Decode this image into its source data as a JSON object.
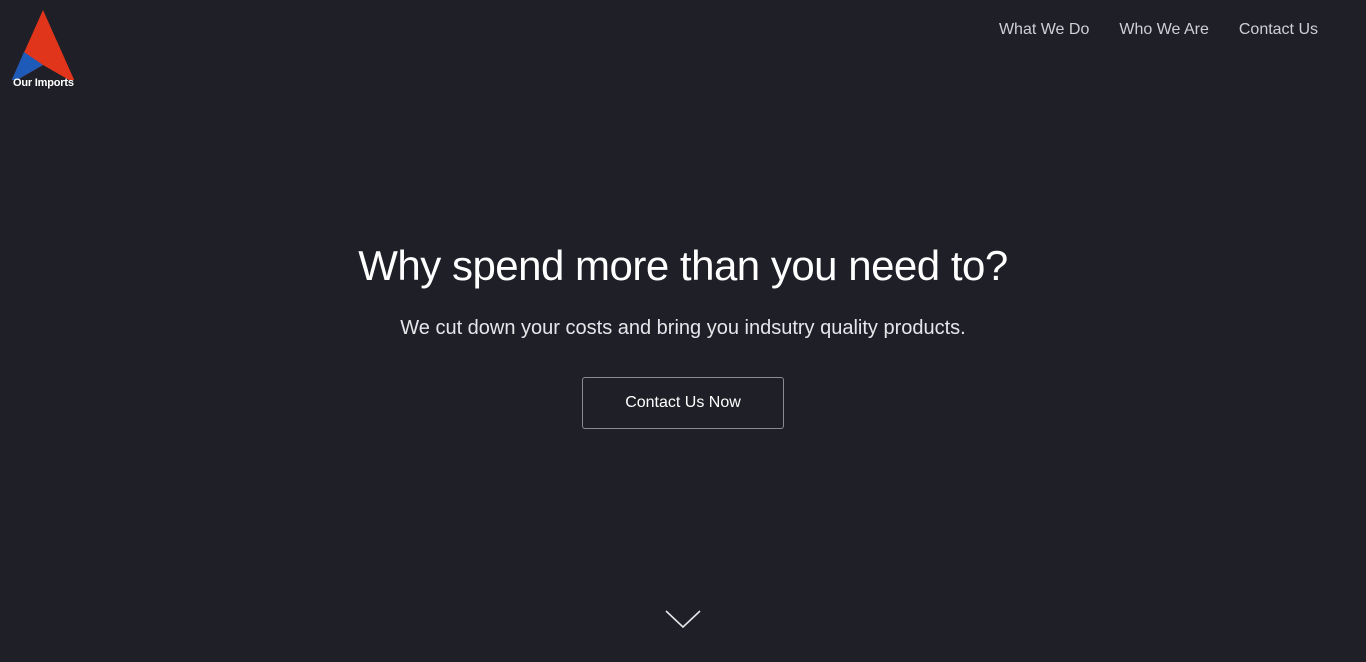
{
  "logo": {
    "text": "Our Imports",
    "colors": {
      "red": "#e0341b",
      "blue": "#1e5bb8"
    }
  },
  "nav": {
    "items": [
      {
        "label": "What We Do"
      },
      {
        "label": "Who We Are"
      },
      {
        "label": "Contact Us"
      }
    ]
  },
  "hero": {
    "headline": "Why spend more than you need to?",
    "subheadline": "We cut down your costs and bring you indsutry quality products.",
    "cta_label": "Contact Us Now",
    "scroll_icon": "chevron-down-icon",
    "background": "#1f1f27"
  }
}
